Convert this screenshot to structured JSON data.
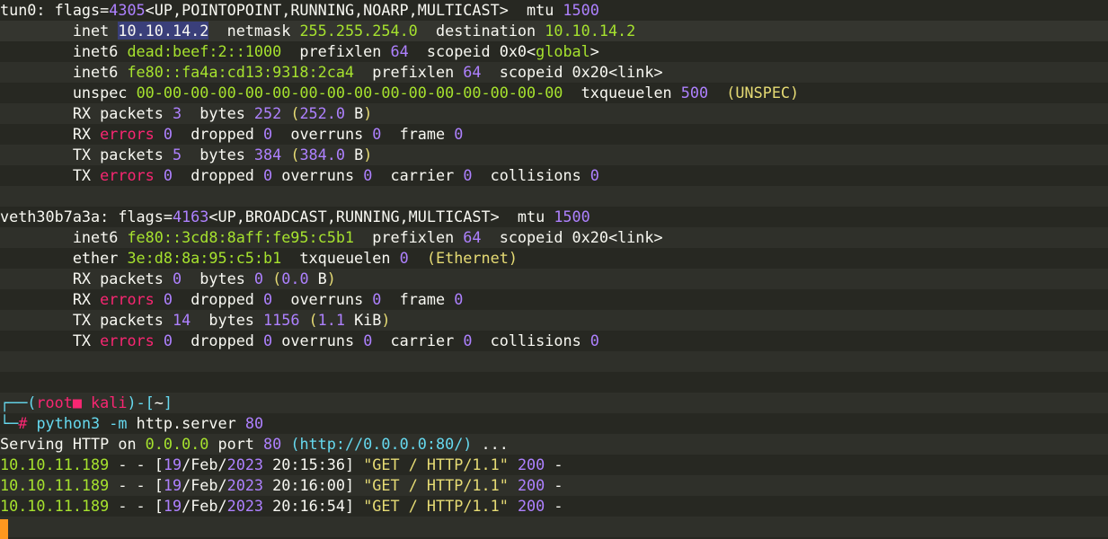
{
  "lines": [
    {
      "style": "",
      "segments": [
        [
          "w",
          "tun0: flags="
        ],
        [
          "p",
          "4305"
        ],
        [
          "w",
          "<UP,POINTOPOINT,RUNNING,NOARP,MULTICAST>  mtu "
        ],
        [
          "p",
          "1500"
        ]
      ]
    },
    {
      "style": "hl",
      "segments": [
        [
          "w",
          "        inet "
        ],
        [
          "sel",
          "10.10.14.2"
        ],
        [
          "w",
          "  netmask "
        ],
        [
          "g",
          "255.255.254.0"
        ],
        [
          "w",
          "  destination "
        ],
        [
          "g",
          "10.10.14.2"
        ]
      ]
    },
    {
      "style": "",
      "segments": [
        [
          "w",
          "        inet6 "
        ],
        [
          "g",
          "dead:beef:2::1000"
        ],
        [
          "w",
          "  prefixlen "
        ],
        [
          "p",
          "64"
        ],
        [
          "w",
          "  scopeid 0x0<"
        ],
        [
          "g",
          "global"
        ],
        [
          "w",
          ">"
        ]
      ]
    },
    {
      "style": "alt",
      "segments": [
        [
          "w",
          "        inet6 "
        ],
        [
          "g",
          "fe80::fa4a:cd13:9318:2ca4"
        ],
        [
          "w",
          "  prefixlen "
        ],
        [
          "p",
          "64"
        ],
        [
          "w",
          "  scopeid 0x20<link>"
        ]
      ]
    },
    {
      "style": "",
      "segments": [
        [
          "w",
          "        unspec "
        ],
        [
          "g",
          "00-00-00-00-00-00-00-00-00-00-00-00-00-00-00-00"
        ],
        [
          "w",
          "  txqueuelen "
        ],
        [
          "p",
          "500"
        ],
        [
          "w",
          "  "
        ],
        [
          "y",
          "(UNSPEC)"
        ]
      ]
    },
    {
      "style": "alt",
      "segments": [
        [
          "w",
          "        RX packets "
        ],
        [
          "p",
          "3"
        ],
        [
          "w",
          "  bytes "
        ],
        [
          "p",
          "252"
        ],
        [
          "w",
          " "
        ],
        [
          "y",
          "("
        ],
        [
          "p",
          "252.0"
        ],
        [
          "w",
          " B"
        ],
        [
          "y",
          ")"
        ]
      ]
    },
    {
      "style": "",
      "segments": [
        [
          "w",
          "        RX "
        ],
        [
          "r",
          "errors"
        ],
        [
          "w",
          " "
        ],
        [
          "p",
          "0"
        ],
        [
          "w",
          "  dropped "
        ],
        [
          "p",
          "0"
        ],
        [
          "w",
          "  overruns "
        ],
        [
          "p",
          "0"
        ],
        [
          "w",
          "  frame "
        ],
        [
          "p",
          "0"
        ]
      ]
    },
    {
      "style": "alt",
      "segments": [
        [
          "w",
          "        TX packets "
        ],
        [
          "p",
          "5"
        ],
        [
          "w",
          "  bytes "
        ],
        [
          "p",
          "384"
        ],
        [
          "w",
          " "
        ],
        [
          "y",
          "("
        ],
        [
          "p",
          "384.0"
        ],
        [
          "w",
          " B"
        ],
        [
          "y",
          ")"
        ]
      ]
    },
    {
      "style": "",
      "segments": [
        [
          "w",
          "        TX "
        ],
        [
          "r",
          "errors"
        ],
        [
          "w",
          " "
        ],
        [
          "p",
          "0"
        ],
        [
          "w",
          "  dropped "
        ],
        [
          "p",
          "0"
        ],
        [
          "w",
          " overruns "
        ],
        [
          "p",
          "0"
        ],
        [
          "w",
          "  carrier "
        ],
        [
          "p",
          "0"
        ],
        [
          "w",
          "  collisions "
        ],
        [
          "p",
          "0"
        ]
      ]
    },
    {
      "style": "alt",
      "segments": []
    },
    {
      "style": "",
      "segments": [
        [
          "w",
          "veth30b7a3a: flags="
        ],
        [
          "p",
          "4163"
        ],
        [
          "w",
          "<UP,BROADCAST,RUNNING,MULTICAST>  mtu "
        ],
        [
          "p",
          "1500"
        ]
      ]
    },
    {
      "style": "alt",
      "segments": [
        [
          "w",
          "        inet6 "
        ],
        [
          "g",
          "fe80::3cd8:8aff:fe95:c5b1"
        ],
        [
          "w",
          "  prefixlen "
        ],
        [
          "p",
          "64"
        ],
        [
          "w",
          "  scopeid 0x20<link>"
        ]
      ]
    },
    {
      "style": "",
      "segments": [
        [
          "w",
          "        ether "
        ],
        [
          "g",
          "3e:d8:8a:95:c5:b1"
        ],
        [
          "w",
          "  txqueuelen "
        ],
        [
          "p",
          "0"
        ],
        [
          "w",
          "  "
        ],
        [
          "y",
          "(Ethernet)"
        ]
      ]
    },
    {
      "style": "alt",
      "segments": [
        [
          "w",
          "        RX packets "
        ],
        [
          "p",
          "0"
        ],
        [
          "w",
          "  bytes "
        ],
        [
          "p",
          "0"
        ],
        [
          "w",
          " "
        ],
        [
          "y",
          "("
        ],
        [
          "p",
          "0.0"
        ],
        [
          "w",
          " B"
        ],
        [
          "y",
          ")"
        ]
      ]
    },
    {
      "style": "",
      "segments": [
        [
          "w",
          "        RX "
        ],
        [
          "r",
          "errors"
        ],
        [
          "w",
          " "
        ],
        [
          "p",
          "0"
        ],
        [
          "w",
          "  dropped "
        ],
        [
          "p",
          "0"
        ],
        [
          "w",
          "  overruns "
        ],
        [
          "p",
          "0"
        ],
        [
          "w",
          "  frame "
        ],
        [
          "p",
          "0"
        ]
      ]
    },
    {
      "style": "alt",
      "segments": [
        [
          "w",
          "        TX packets "
        ],
        [
          "p",
          "14"
        ],
        [
          "w",
          "  bytes "
        ],
        [
          "p",
          "1156"
        ],
        [
          "w",
          " "
        ],
        [
          "y",
          "("
        ],
        [
          "p",
          "1.1"
        ],
        [
          "w",
          " KiB"
        ],
        [
          "y",
          ")"
        ]
      ]
    },
    {
      "style": "",
      "segments": [
        [
          "w",
          "        TX "
        ],
        [
          "r",
          "errors"
        ],
        [
          "w",
          " "
        ],
        [
          "p",
          "0"
        ],
        [
          "w",
          "  dropped "
        ],
        [
          "p",
          "0"
        ],
        [
          "w",
          " overruns "
        ],
        [
          "p",
          "0"
        ],
        [
          "w",
          "  carrier "
        ],
        [
          "p",
          "0"
        ],
        [
          "w",
          "  collisions "
        ],
        [
          "p",
          "0"
        ]
      ]
    },
    {
      "style": "alt",
      "segments": []
    },
    {
      "style": "",
      "segments": []
    },
    {
      "style": "alt",
      "segments": [
        [
          "b",
          "┌──("
        ],
        [
          "r",
          "root■ kali"
        ],
        [
          "b",
          ")-["
        ],
        [
          "w",
          "~"
        ],
        [
          "b",
          "]"
        ]
      ]
    },
    {
      "style": "",
      "segments": [
        [
          "b",
          "└─"
        ],
        [
          "r",
          "# "
        ],
        [
          "b",
          "python3"
        ],
        [
          "w",
          " "
        ],
        [
          "b",
          "-m"
        ],
        [
          "w",
          " http.server "
        ],
        [
          "p",
          "80"
        ]
      ]
    },
    {
      "style": "alt",
      "segments": [
        [
          "w",
          "Serving HTTP on "
        ],
        [
          "g",
          "0.0.0.0"
        ],
        [
          "w",
          " port "
        ],
        [
          "p",
          "80"
        ],
        [
          "w",
          " "
        ],
        [
          "b",
          "(http://0.0.0.0:80/)"
        ],
        [
          "w",
          " ..."
        ]
      ]
    },
    {
      "style": "",
      "segments": [
        [
          "g",
          "10.10.11.189"
        ],
        [
          "w",
          " - - ["
        ],
        [
          "p",
          "19"
        ],
        [
          "w",
          "/Feb/"
        ],
        [
          "p",
          "2023"
        ],
        [
          "w",
          " 20:15:36] "
        ],
        [
          "y",
          "\"GET / HTTP/1.1\""
        ],
        [
          "w",
          " "
        ],
        [
          "p",
          "200"
        ],
        [
          "w",
          " -"
        ]
      ]
    },
    {
      "style": "alt",
      "segments": [
        [
          "g",
          "10.10.11.189"
        ],
        [
          "w",
          " - - ["
        ],
        [
          "p",
          "19"
        ],
        [
          "w",
          "/Feb/"
        ],
        [
          "p",
          "2023"
        ],
        [
          "w",
          " 20:16:00] "
        ],
        [
          "y",
          "\"GET / HTTP/1.1\""
        ],
        [
          "w",
          " "
        ],
        [
          "p",
          "200"
        ],
        [
          "w",
          " -"
        ]
      ]
    },
    {
      "style": "",
      "segments": [
        [
          "g",
          "10.10.11.189"
        ],
        [
          "w",
          " - - ["
        ],
        [
          "p",
          "19"
        ],
        [
          "w",
          "/Feb/"
        ],
        [
          "p",
          "2023"
        ],
        [
          "w",
          " 20:16:54] "
        ],
        [
          "y",
          "\"GET / HTTP/1.1\""
        ],
        [
          "w",
          " "
        ],
        [
          "p",
          "200"
        ],
        [
          "w",
          " -"
        ]
      ]
    },
    {
      "style": "alt",
      "segments": []
    }
  ],
  "colors": {
    "background": "#272822",
    "text": "#f8f8f2",
    "green": "#a6e22e",
    "purple": "#ae81ff",
    "red": "#f92672",
    "cyan": "#66d9ef",
    "yellow": "#e6db74",
    "cursor": "#fd971f",
    "selection": "#3a3f7a"
  },
  "icons": {
    "prompt_glyph": "root-skull-square-icon",
    "cursor": "block-cursor-icon"
  }
}
